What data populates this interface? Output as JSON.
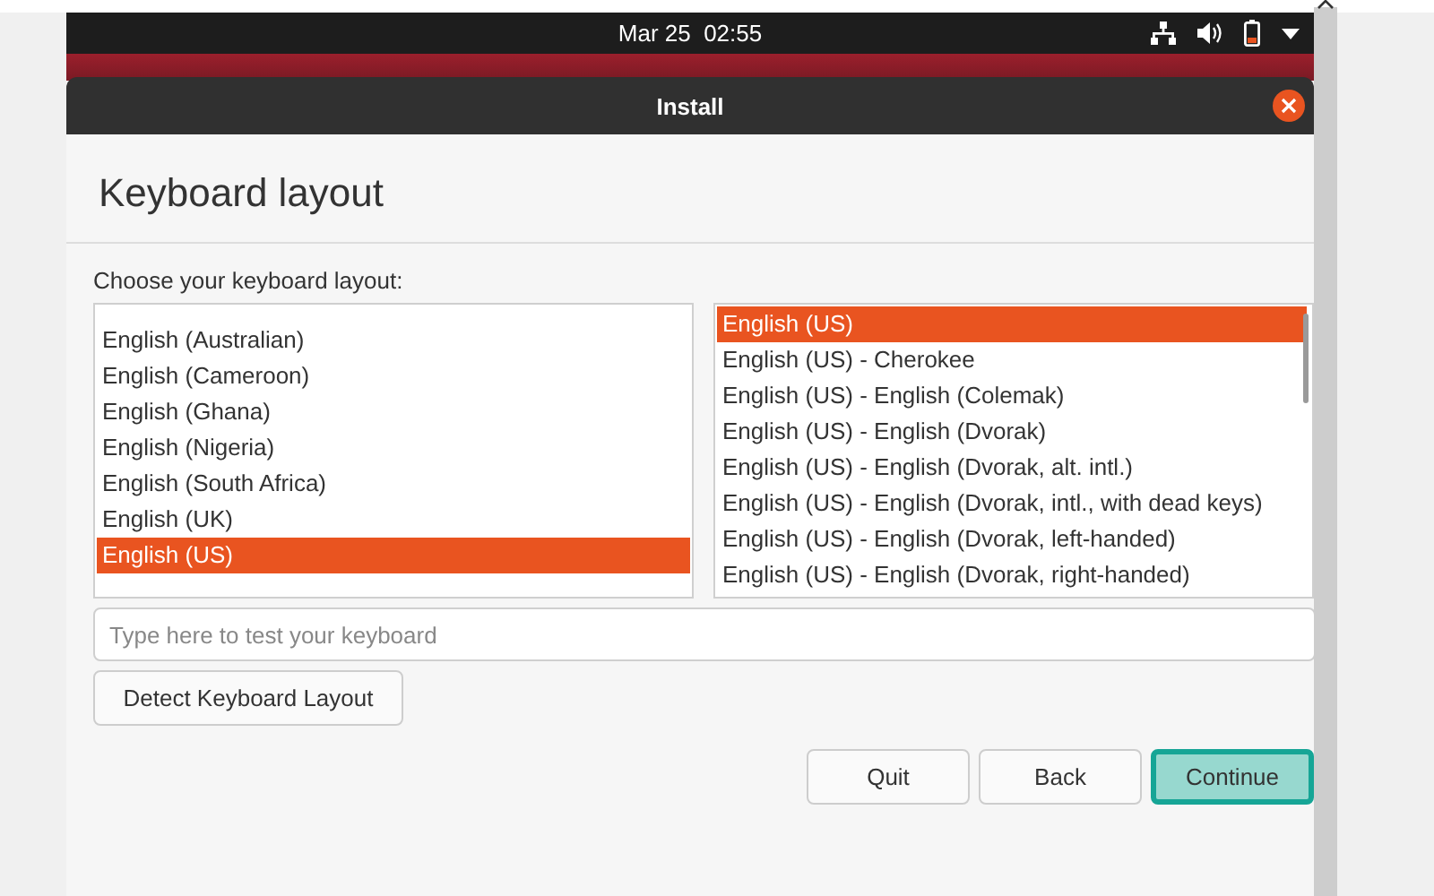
{
  "top_bar": {
    "clock": "Mar 25  02:55"
  },
  "window": {
    "title": "Install"
  },
  "page": {
    "heading": "Keyboard layout",
    "prompt": "Choose your keyboard layout:"
  },
  "layouts": [
    {
      "label": "English (Australian)",
      "selected": false
    },
    {
      "label": "English (Cameroon)",
      "selected": false
    },
    {
      "label": "English (Ghana)",
      "selected": false
    },
    {
      "label": "English (Nigeria)",
      "selected": false
    },
    {
      "label": "English (South Africa)",
      "selected": false
    },
    {
      "label": "English (UK)",
      "selected": false
    },
    {
      "label": "English (US)",
      "selected": true
    }
  ],
  "variants": [
    {
      "label": "English (US)",
      "selected": true
    },
    {
      "label": "English (US) - Cherokee",
      "selected": false
    },
    {
      "label": "English (US) - English (Colemak)",
      "selected": false
    },
    {
      "label": "English (US) - English (Dvorak)",
      "selected": false
    },
    {
      "label": "English (US) - English (Dvorak, alt. intl.)",
      "selected": false
    },
    {
      "label": "English (US) - English (Dvorak, intl., with dead keys)",
      "selected": false
    },
    {
      "label": "English (US) - English (Dvorak, left-handed)",
      "selected": false
    },
    {
      "label": "English (US) - English (Dvorak, right-handed)",
      "selected": false
    }
  ],
  "test_field": {
    "placeholder": "Type here to test your keyboard"
  },
  "detect_button": {
    "label": "Detect Keyboard Layout"
  },
  "buttons": [
    {
      "label": "Quit",
      "kind": "normal"
    },
    {
      "label": "Back",
      "kind": "normal"
    },
    {
      "label": "Continue",
      "kind": "suggested"
    }
  ]
}
